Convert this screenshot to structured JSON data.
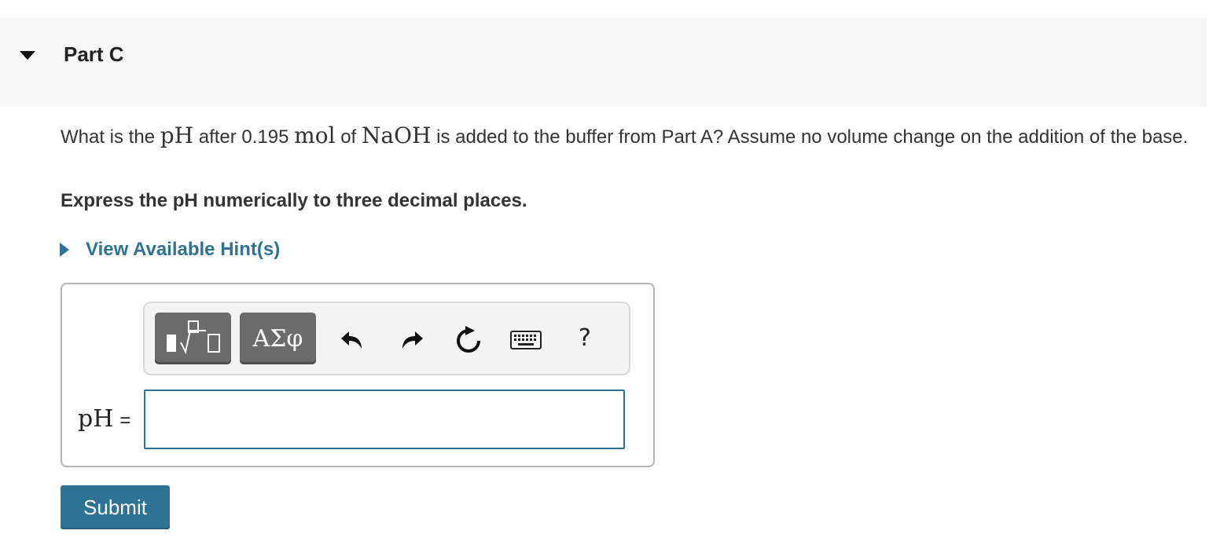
{
  "part": {
    "title": "Part C"
  },
  "question": {
    "t1": "What is the ",
    "m1": "pH",
    "t2": " after 0.195 ",
    "m2": "mol",
    "t3": " of ",
    "m3": "NaOH",
    "t4": " is added to the buffer from Part A? Assume no volume change on the addition of the base."
  },
  "instruction": "Express the pH numerically to three decimal places.",
  "hint": {
    "label": "View Available Hint(s)"
  },
  "toolbar": {
    "greek_label": "ΑΣφ",
    "help_label": "?"
  },
  "answer": {
    "variable": "pH",
    "equals": "=",
    "value": ""
  },
  "submit": {
    "label": "Submit"
  },
  "colors": {
    "accent": "#2e7294",
    "header_bg": "#f6f6f6",
    "toolbar_button": "#6b6b6b"
  }
}
